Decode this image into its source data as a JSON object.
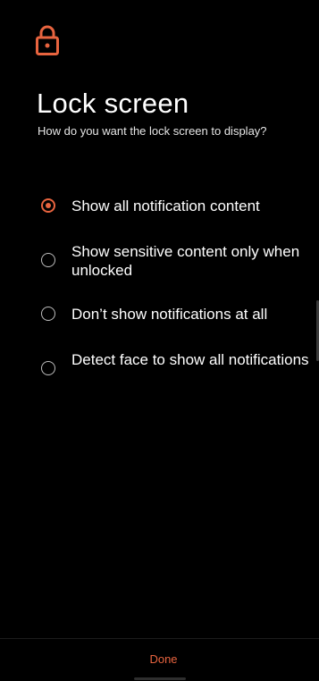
{
  "header": {
    "icon": "lock-icon",
    "title": "Lock screen",
    "subtitle": "How do you want the lock screen to display?"
  },
  "options": [
    {
      "label": "Show all notification content",
      "selected": true
    },
    {
      "label": "Show sensitive content only when unlocked",
      "selected": false
    },
    {
      "label": "Don’t show notifications at all",
      "selected": false
    },
    {
      "label": "Detect face to show all notifications",
      "selected": false
    }
  ],
  "footer": {
    "done_label": "Done"
  },
  "colors": {
    "accent": "#e8643f",
    "background": "#000000",
    "text": "#ffffff"
  }
}
